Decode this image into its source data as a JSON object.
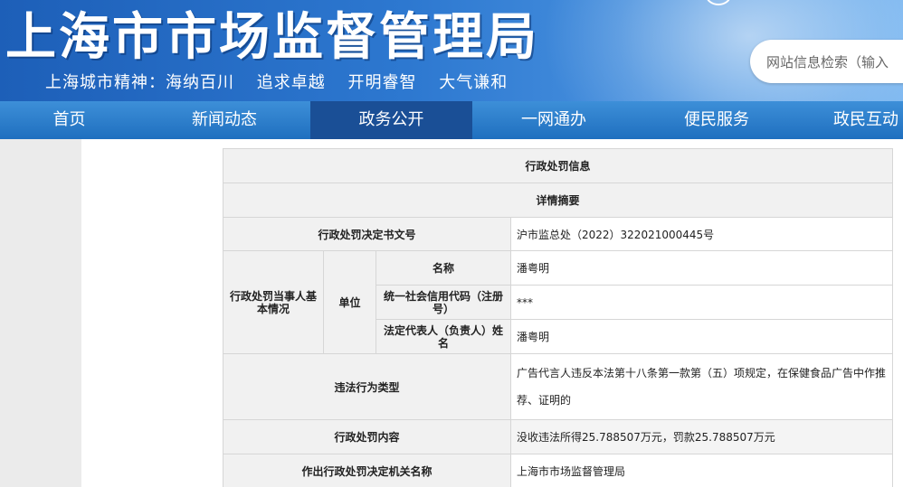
{
  "header": {
    "title": "上海市市场监督管理局",
    "slogan": [
      "上海城市精神：海纳百川",
      "追求卓越",
      "开明睿智",
      "大气谦和"
    ],
    "search_placeholder": "网站信息检索（输入"
  },
  "nav": {
    "items": [
      "首页",
      "新闻动态",
      "政务公开",
      "一网通办",
      "便民服务",
      "政民互动"
    ],
    "active_index": 2
  },
  "table": {
    "title": "行政处罚信息",
    "subtitle": "详情摘要",
    "doc_no_label": "行政处罚决定书文号",
    "doc_no_value": "沪市监总处（2022）322021000445号",
    "party_label": "行政处罚当事人基本情况",
    "unit_label": "单位",
    "name_label": "名称",
    "name_value": "潘粤明",
    "credit_code_label": "统一社会信用代码（注册号）",
    "credit_code_value": "***",
    "legal_rep_label": "法定代表人（负责人）姓名",
    "legal_rep_value": "潘粤明",
    "violation_type_label": "违法行为类型",
    "violation_type_value": "广告代言人违反本法第十八条第一款第（五）项规定，在保健食品广告中作推荐、证明的",
    "penalty_content_label": "行政处罚内容",
    "penalty_content_value": "没收违法所得25.788507万元，罚款25.788507万元",
    "authority_label": "作出行政处罚决定机关名称",
    "authority_value": "上海市市场监督管理局"
  }
}
